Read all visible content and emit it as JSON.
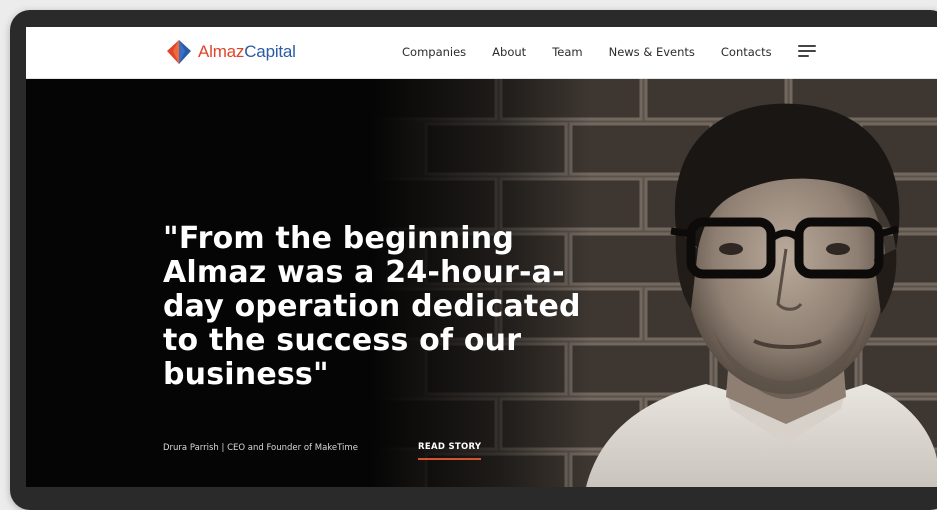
{
  "header": {
    "logo": {
      "brand_part1": "Almaz",
      "brand_part2": "Capital",
      "icon": "almaz-diamond-logo-icon",
      "colors": {
        "red": "#e0452b",
        "blue": "#2b5aa7"
      }
    },
    "nav": [
      {
        "label": "Companies"
      },
      {
        "label": "About"
      },
      {
        "label": "Team"
      },
      {
        "label": "News & Events"
      },
      {
        "label": "Contacts"
      }
    ],
    "menu_icon": "hamburger-menu-icon"
  },
  "hero": {
    "quote": "\"From the beginning Almaz was a 24-hour-a-day operation dedicated to the success of our business\"",
    "attribution": "Drura Parrish | CEO and Founder of MakeTime",
    "read_story_label": "READ STORY",
    "accent_color": "#d4542f"
  }
}
